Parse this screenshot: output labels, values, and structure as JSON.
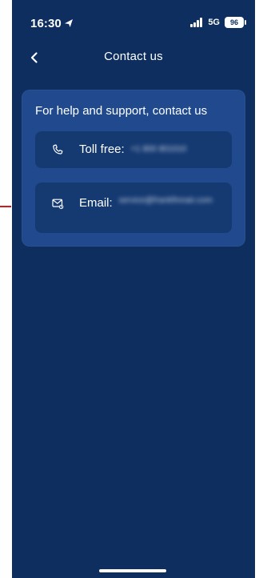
{
  "status_bar": {
    "time": "16:30",
    "network": "5G",
    "battery": "96"
  },
  "nav": {
    "title": "Contact us",
    "back_icon": "chevron-left-icon"
  },
  "contact": {
    "title": "For help and support, contact us",
    "toll_free": {
      "label": "Toll free:",
      "value": "+1 800 801010",
      "icon": "phone-icon"
    },
    "email": {
      "label": "Email:",
      "value": "service@frankfinnair.com",
      "icon": "email-icon"
    }
  },
  "colors": {
    "background": "#0d2e5f",
    "card": "#204a8d",
    "row": "#153a72",
    "text": "#ffffff",
    "edge_marker": "#cf1b1b"
  }
}
